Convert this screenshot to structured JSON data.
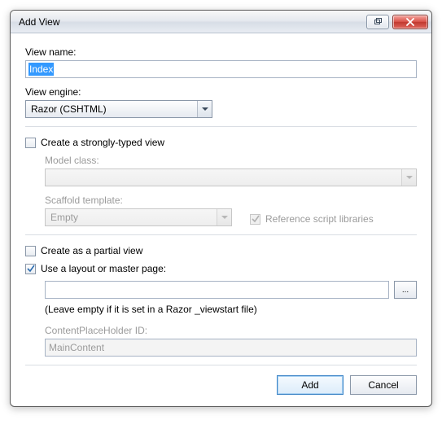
{
  "window": {
    "title": "Add View"
  },
  "viewName": {
    "label": "View name:",
    "value": "Index"
  },
  "viewEngine": {
    "label": "View engine:",
    "value": "Razor (CSHTML)"
  },
  "stronglyTyped": {
    "label": "Create a strongly-typed view",
    "checked": false,
    "modelClass": {
      "label": "Model class:",
      "value": ""
    },
    "scaffold": {
      "label": "Scaffold template:",
      "value": "Empty"
    },
    "refScript": {
      "label": "Reference script libraries",
      "checked": true
    }
  },
  "partialView": {
    "label": "Create as a partial view",
    "checked": false
  },
  "layout": {
    "label": "Use a layout or master page:",
    "checked": true,
    "path": "",
    "hint": "(Leave empty if it is set in a Razor _viewstart file)",
    "placeholder": {
      "label": "ContentPlaceHolder ID:",
      "value": "MainContent"
    },
    "browse": "..."
  },
  "buttons": {
    "add": "Add",
    "cancel": "Cancel"
  }
}
